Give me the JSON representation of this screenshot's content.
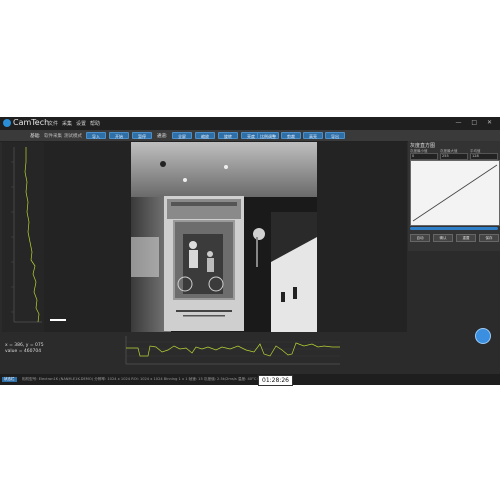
{
  "app": {
    "title": "CamTech",
    "menus": [
      "文件",
      "采集",
      "设置",
      "帮助"
    ],
    "window_controls": "— □ ✕"
  },
  "toolbar": {
    "group1_label": "基础:",
    "group1_sub": [
      "软件采集",
      "测试模式"
    ],
    "group1_buttons": [
      "导入",
      "开始",
      "暂停"
    ],
    "group2_label": "通道:",
    "group2_buttons": [
      "全屏",
      "缩放",
      "旋转",
      "亮度",
      "比例调整",
      "剪裁",
      "高亮",
      "导出"
    ]
  },
  "histogram": {
    "title": "灰度直方图",
    "captions": [
      "灰度最小值",
      "灰度最大值",
      "平均值"
    ],
    "fields": [
      "0",
      "255",
      "128"
    ],
    "buttons": [
      "自动",
      "确认",
      "重置",
      "保存"
    ]
  },
  "readout": {
    "line1": "x = 386, y = 075",
    "line2": "value = 460704"
  },
  "fab_label": "",
  "status": {
    "tag": "状态栏",
    "text": "相机型号: Electron1K (NANM-E1K-DEMO)  分辨率: 1024 x 1024  ROI: 1024 x 1024  Binning 1 x 1  帧速: 15  灰度值: 2.5k/2ms/s  温度: 40°C  帧速: 15.0749 °C"
  },
  "clock": "01:28:26",
  "colors": {
    "accent": "#2f6fa8",
    "fab": "#3a8fe0",
    "trace": "#b7d434"
  }
}
